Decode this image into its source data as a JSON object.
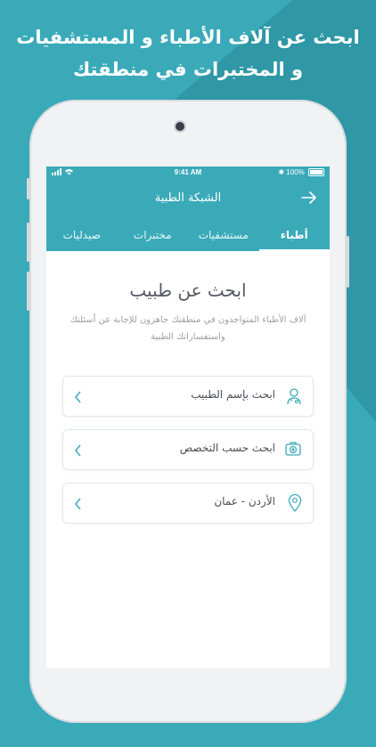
{
  "headline": {
    "line1": "ابحث عن آلاف الأطباء و المستشفيات",
    "line2": "و المختبرات في منطقتك"
  },
  "status_bar": {
    "time": "9:41 AM",
    "battery": "100%"
  },
  "nav": {
    "title": "الشبكة الطبية"
  },
  "tabs": [
    {
      "label": "أطباء",
      "active": true
    },
    {
      "label": "مستشفيات",
      "active": false
    },
    {
      "label": "مختبرات",
      "active": false
    },
    {
      "label": "صيدليات",
      "active": false
    }
  ],
  "main": {
    "title": "ابحث عن طبيب",
    "subtitle": "آلاف الأطباء المتواجدون في منطقتك جاهزون للإجابة عن أسئلتك واستفساراتك الطبية"
  },
  "fields": [
    {
      "label": "ابحث بإسم الطبيب",
      "icon": "doctor-icon"
    },
    {
      "label": "ابحث حسب التخصص",
      "icon": "medical-kit-icon"
    },
    {
      "label": "الأردن - عمان",
      "icon": "location-pin-icon"
    }
  ],
  "colors": {
    "accent": "#3aaab9",
    "background": "#3aaab9",
    "screen_bg": "#ffffff"
  }
}
